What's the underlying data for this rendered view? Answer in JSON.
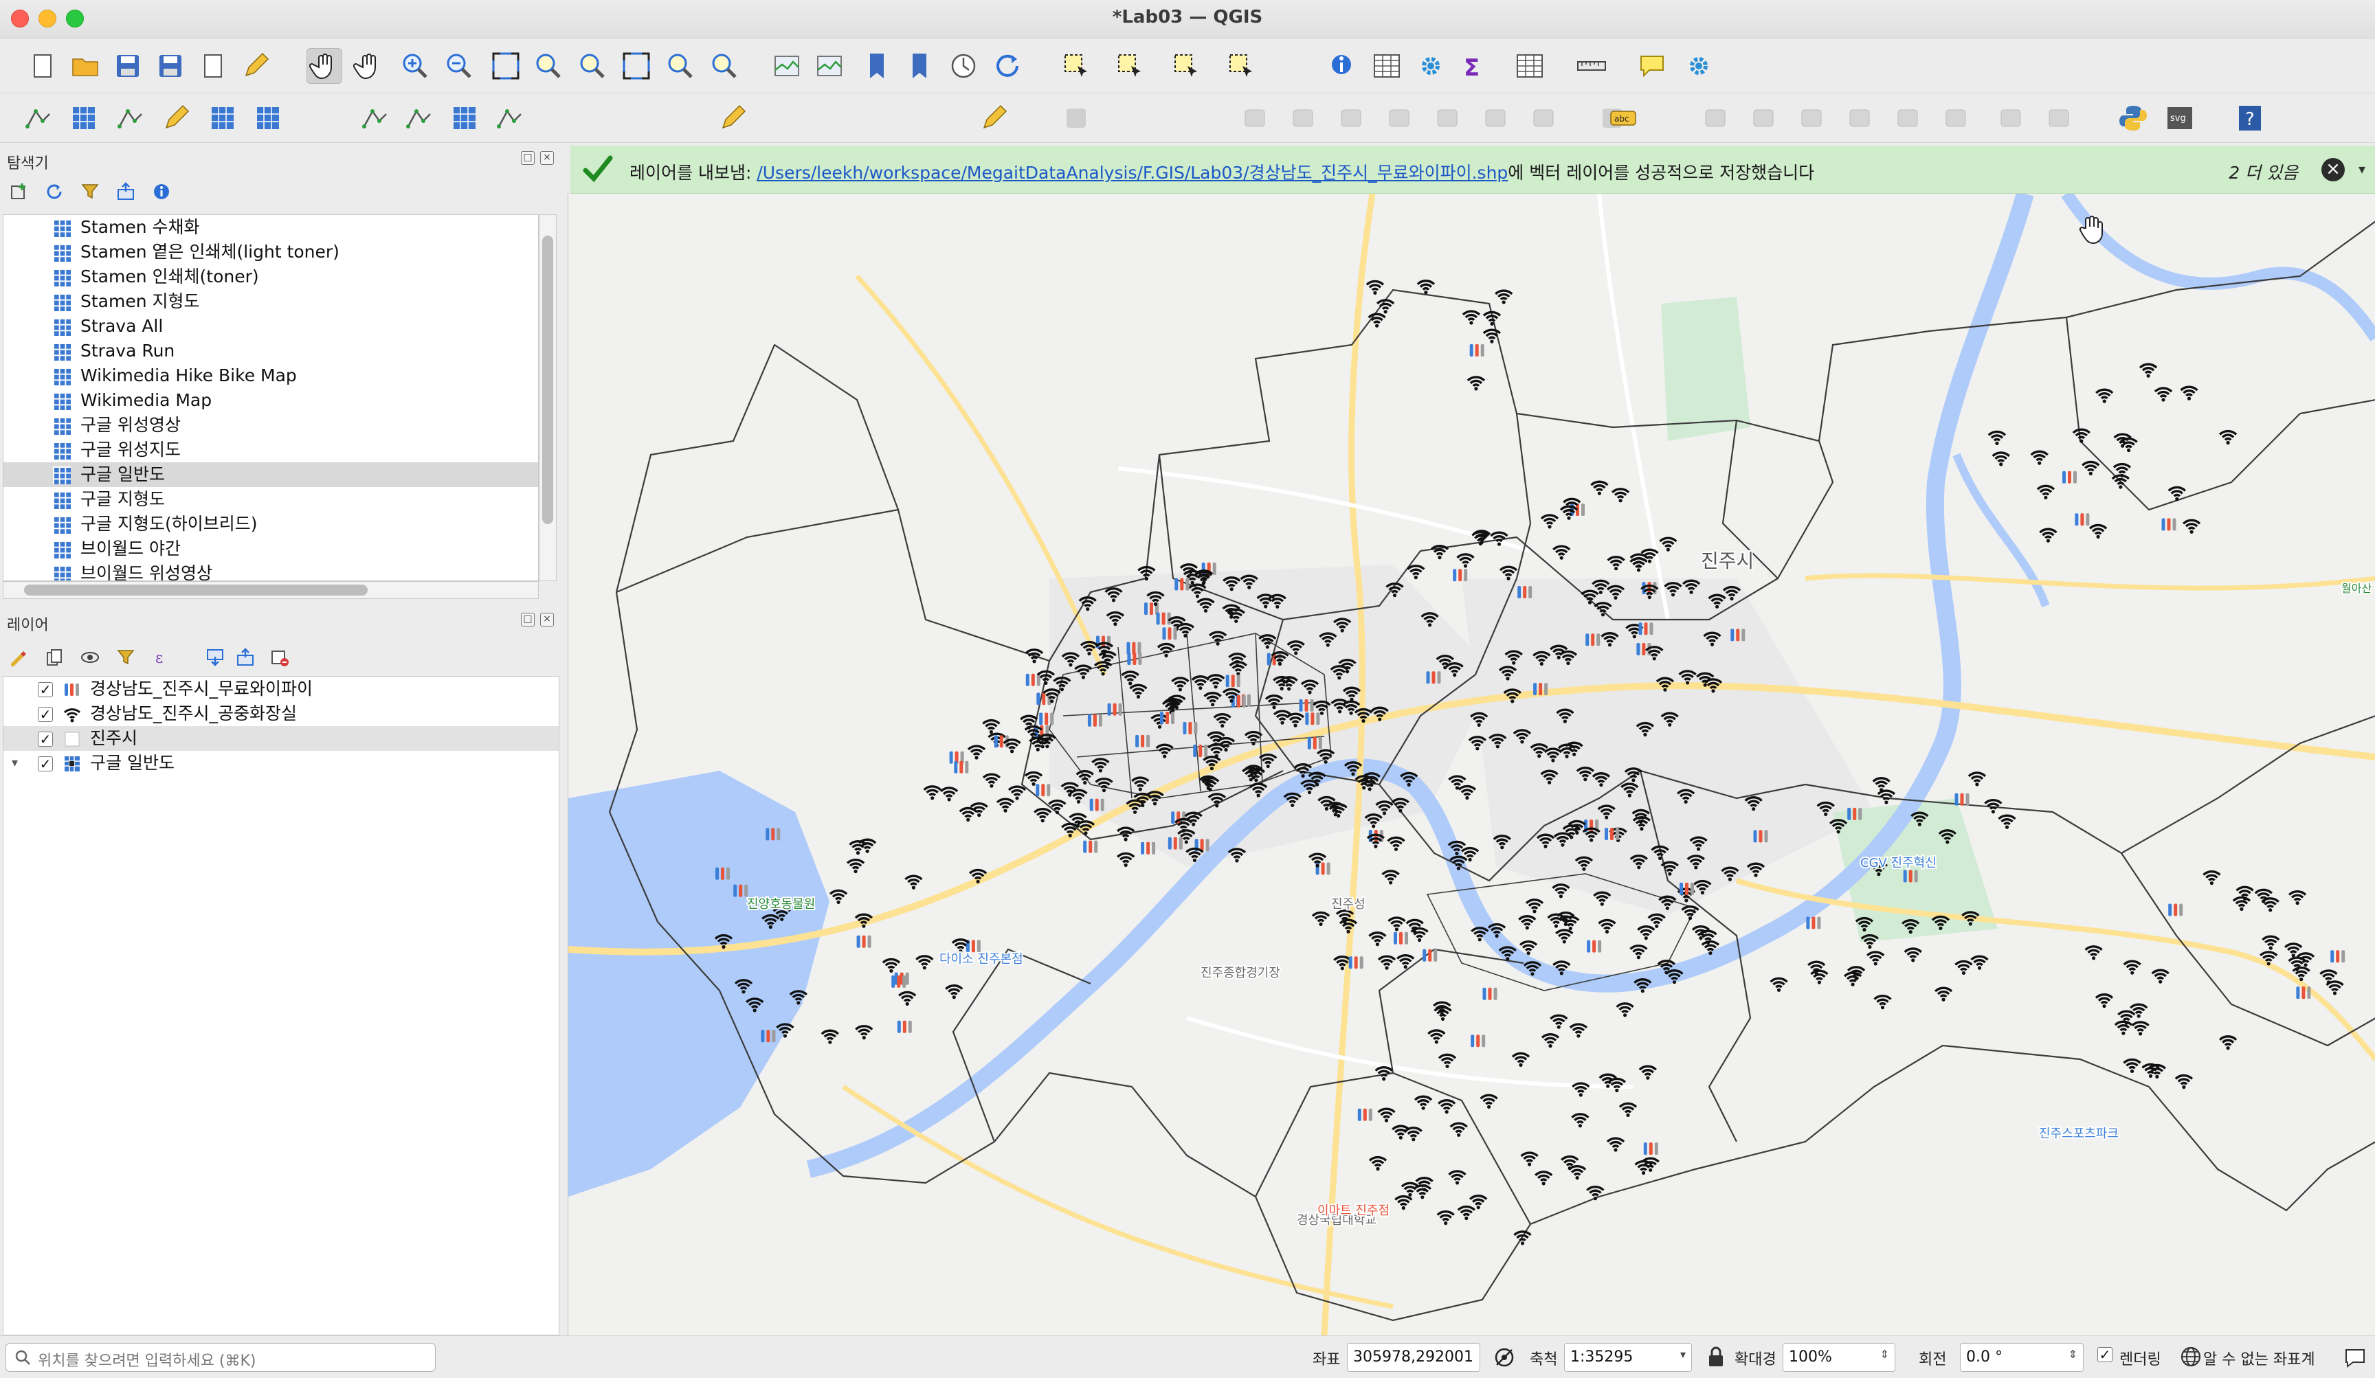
{
  "window": {
    "title": "*Lab03 — QGIS"
  },
  "toolbar1": {
    "buttons": [
      "new-project",
      "open-project",
      "save-project",
      "save-as",
      "print-layout",
      "style-manager",
      "pan",
      "pan-to-selection",
      "zoom-in",
      "zoom-out",
      "zoom-full",
      "zoom-to-selection",
      "zoom-to-layer",
      "zoom-native",
      "zoom-last",
      "zoom-next",
      "new-map-view",
      "new-3d-view",
      "new-bookmark",
      "show-bookmarks",
      "temporal-controller",
      "refresh",
      "select-features",
      "select-by-value",
      "deselect",
      "select-by-location",
      "identify",
      "attribute-table",
      "processing-toolbox",
      "statistics",
      "open-field-calculator",
      "measure",
      "map-tips",
      "settings"
    ]
  },
  "toolbar2": {
    "buttons": [
      "add-vector-layer",
      "add-raster-layer",
      "add-delimited-text",
      "add-spatialite",
      "add-wms",
      "add-wfs",
      "add-xyz",
      "new-shapefile",
      "new-geopackage",
      "new-scratch",
      "digitize",
      "toggle-edit",
      "save-edits",
      "add-feature",
      "label",
      "python-console",
      "svg",
      "help"
    ]
  },
  "browser_panel": {
    "title": "탐색기",
    "items": [
      {
        "label": "Stamen 수채화"
      },
      {
        "label": "Stamen 옅은 인쇄체(light toner)"
      },
      {
        "label": "Stamen 인쇄체(toner)"
      },
      {
        "label": "Stamen 지형도"
      },
      {
        "label": "Strava All"
      },
      {
        "label": "Strava Run"
      },
      {
        "label": "Wikimedia Hike Bike Map"
      },
      {
        "label": "Wikimedia Map"
      },
      {
        "label": "구글 위성영상"
      },
      {
        "label": "구글 위성지도"
      },
      {
        "label": "구글 일반도"
      },
      {
        "label": "구글 지형도"
      },
      {
        "label": "구글 지형도(하이브리드)"
      },
      {
        "label": "브이월드 야간"
      },
      {
        "label": "브이월드 위성영상"
      }
    ],
    "selected_index": 10
  },
  "layers_panel": {
    "title": "레이어",
    "items": [
      {
        "label": "경상남도_진주시_무료와이파이",
        "checked": "✓",
        "symbol": "wifi-colored"
      },
      {
        "label": "경상남도_진주시_공중화장실",
        "checked": "✓",
        "symbol": "wifi"
      },
      {
        "label": "진주시",
        "checked": "✓",
        "symbol": "polygon"
      },
      {
        "label": "구글 일반도",
        "checked": "✓",
        "symbol": "raster"
      }
    ]
  },
  "message_bar": {
    "prefix": "레이어를 내보냄:",
    "path": "/Users/leekh/workspace/MegaitDataAnalysis/F.GIS/Lab03/경상남도_진주시_무료와이파이.shp",
    "suffix": "에 벡터 레이어를 성공적으로 저장했습니다",
    "more": "2 더 있음",
    "close": "×",
    "accent": "#1f8a1f"
  },
  "map": {
    "labels": [
      {
        "text": "진주시"
      },
      {
        "text": "경상국립대학교"
      },
      {
        "text": "진주종합경기장"
      },
      {
        "text": "이마트 진주점"
      },
      {
        "text": "CGV 진주혁신"
      },
      {
        "text": "진주스포츠파크"
      },
      {
        "text": "다이소 진주본점"
      },
      {
        "text": "진양호동물원"
      },
      {
        "text": "진주성"
      },
      {
        "text": "월아산 숲속의 진주"
      }
    ],
    "colors": {
      "river": "#aecbfa",
      "road_major": "#fde293",
      "boundary": "#3c3c3c",
      "park": "#cfe9d2",
      "urban": "#e6e6e6",
      "wifi": "#111111",
      "toilet": "#e8533a",
      "toilet2": "#3c7fd9"
    }
  },
  "statusbar": {
    "locator_placeholder": "위치를 찾으려면 입력하세요 (⌘K)",
    "coord_label": "좌표",
    "coord_value": "305978,292001",
    "scale_label": "축척",
    "scale_value": "1:35295",
    "magnifier_label": "확대경",
    "magnifier_value": "100%",
    "rotation_label": "회전",
    "rotation_value": "0.0 °",
    "render_label": "렌더링",
    "render_checked": "✓",
    "crs_label": "알 수 없는 좌표계"
  }
}
